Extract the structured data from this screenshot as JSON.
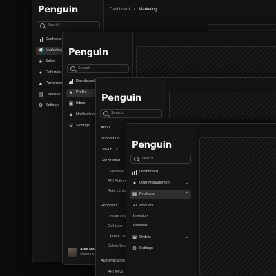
{
  "app": {
    "logo": "Penguin"
  },
  "search": {
    "placeholder": "Search"
  },
  "breadcrumb": {
    "root": "Dashboard",
    "separator": ">",
    "current": "Marketing"
  },
  "window1": {
    "nav": [
      {
        "label": "Dashboard"
      },
      {
        "label": "Marketing"
      },
      {
        "label": "Sales"
      },
      {
        "label": "Referrals"
      },
      {
        "label": "Performance"
      },
      {
        "label": "Licenses"
      },
      {
        "label": "Settings"
      }
    ]
  },
  "window2": {
    "nav": [
      {
        "label": "Dashboard"
      },
      {
        "label": "Profile"
      },
      {
        "label": "Inbox"
      },
      {
        "label": "Notifications"
      },
      {
        "label": "Settings"
      }
    ],
    "user": {
      "name": "Alex Ma",
      "email": "@alexma"
    }
  },
  "window3": {
    "links": [
      "About",
      "Support Us",
      "GitHub"
    ],
    "sections": [
      {
        "title": "Get Started",
        "items": [
          "Overview",
          "API Authentication",
          "Rate Limits"
        ]
      },
      {
        "title": "Endpoints",
        "items": [
          "Create User",
          "Get User",
          "Update User",
          "Delete User"
        ]
      },
      {
        "title": "Authentication",
        "items": [
          "API Keys"
        ]
      }
    ]
  },
  "window4": {
    "nav": [
      {
        "label": "Dashboard"
      },
      {
        "label": "User Management"
      },
      {
        "label": "Products"
      },
      {
        "label": "Orders"
      },
      {
        "label": "Settings"
      }
    ],
    "products_sub": [
      "All Products",
      "Inventory",
      "Reviews"
    ]
  },
  "colors": {
    "background": "#0b0b0b",
    "panel": "#151515",
    "active": "#2e2e2e",
    "close": "#ef5a4f",
    "minimize": "#f2be2f",
    "maximize": "#38c24a"
  }
}
